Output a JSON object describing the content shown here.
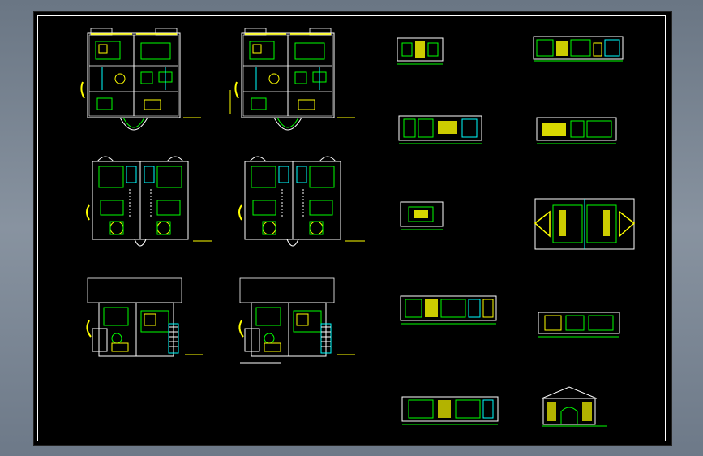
{
  "app": {
    "title": "",
    "background_color": "#76818f",
    "canvas_color": "#000000"
  },
  "palette": {
    "wall": "#ffffff",
    "furniture": "#00ff00",
    "accent": "#ffff00",
    "detail": "#00ffff",
    "dim": "#ff00ff"
  },
  "drawings": {
    "floor_plans": [
      {
        "id": "plan-1",
        "row": 1,
        "col": 1
      },
      {
        "id": "plan-2",
        "row": 1,
        "col": 2
      },
      {
        "id": "plan-3",
        "row": 2,
        "col": 1
      },
      {
        "id": "plan-4",
        "row": 2,
        "col": 2
      },
      {
        "id": "plan-5",
        "row": 3,
        "col": 1
      },
      {
        "id": "plan-6",
        "row": 3,
        "col": 2
      }
    ],
    "elevations": [
      {
        "id": "elev-1"
      },
      {
        "id": "elev-2"
      },
      {
        "id": "elev-3"
      },
      {
        "id": "elev-4"
      },
      {
        "id": "elev-5"
      },
      {
        "id": "elev-6"
      },
      {
        "id": "elev-7"
      },
      {
        "id": "elev-8"
      },
      {
        "id": "elev-9"
      },
      {
        "id": "elev-10"
      }
    ]
  }
}
